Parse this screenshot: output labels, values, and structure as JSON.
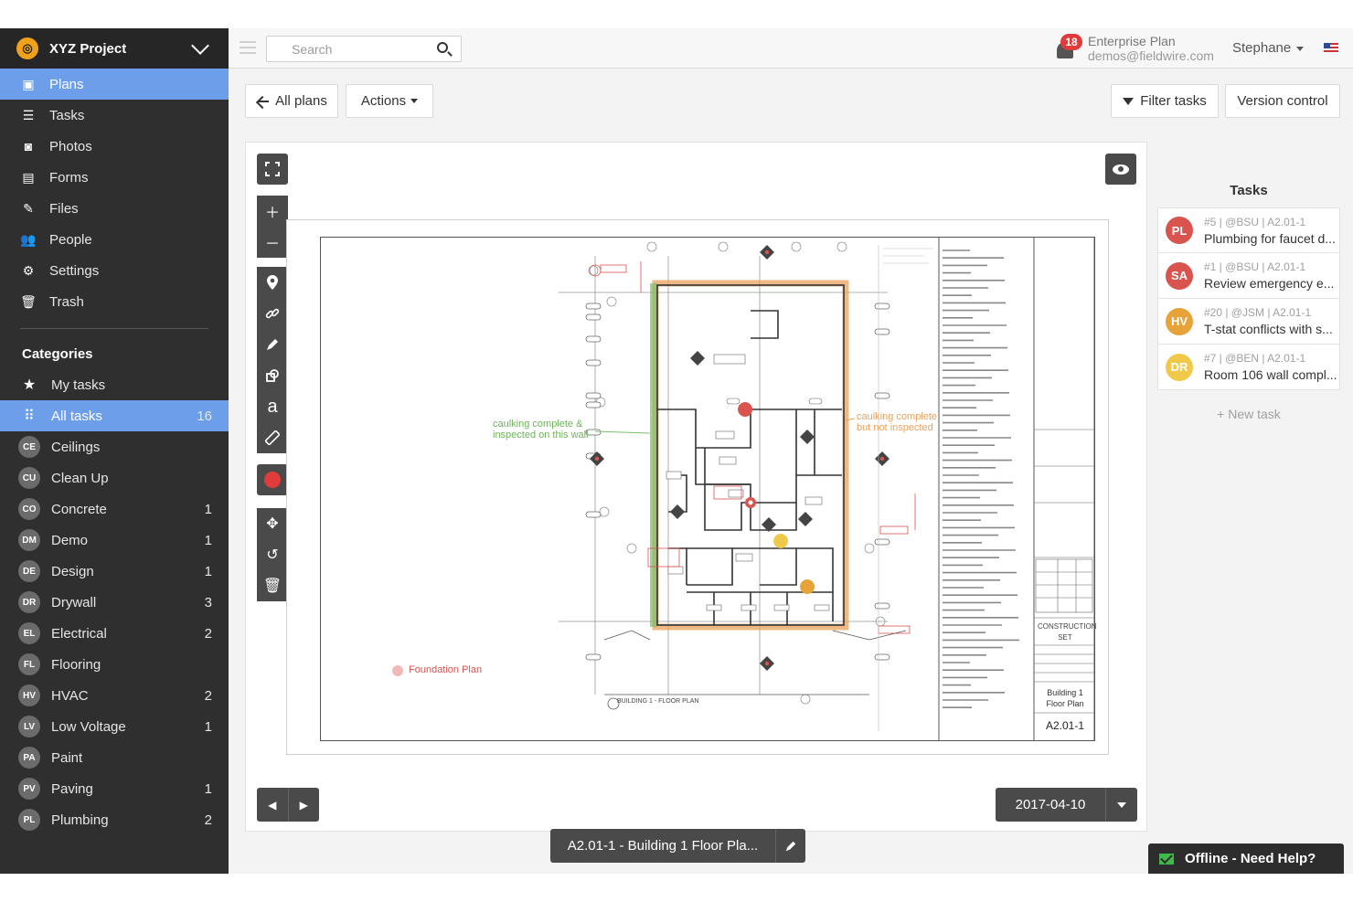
{
  "colors": {
    "sidebar_bg": "#2f2f2f",
    "accent": "#6d9ee9",
    "pin_red": "#d9534f",
    "pin_orange": "#e8a23a",
    "pin_yellow": "#f0c94a",
    "markup_orange": "#e8a25c",
    "markup_green": "#7cbf6b"
  },
  "project": {
    "name": "XYZ Project"
  },
  "nav": [
    {
      "label": "Plans",
      "icon": "plans-icon",
      "active": true
    },
    {
      "label": "Tasks",
      "icon": "list-icon"
    },
    {
      "label": "Photos",
      "icon": "camera-icon"
    },
    {
      "label": "Forms",
      "icon": "clipboard-icon"
    },
    {
      "label": "Files",
      "icon": "paperclip-icon"
    },
    {
      "label": "People",
      "icon": "people-icon"
    },
    {
      "label": "Settings",
      "icon": "gear-icon"
    },
    {
      "label": "Trash",
      "icon": "trash-icon"
    }
  ],
  "categories": {
    "title": "Categories",
    "items": [
      {
        "badge": "",
        "label": "My tasks",
        "count": ""
      },
      {
        "badge": "",
        "label": "All tasks",
        "count": "16",
        "active": true
      },
      {
        "badge": "CE",
        "label": "Ceilings",
        "count": ""
      },
      {
        "badge": "CU",
        "label": "Clean Up",
        "count": ""
      },
      {
        "badge": "CO",
        "label": "Concrete",
        "count": "1"
      },
      {
        "badge": "DM",
        "label": "Demo",
        "count": "1"
      },
      {
        "badge": "DE",
        "label": "Design",
        "count": "1"
      },
      {
        "badge": "DR",
        "label": "Drywall",
        "count": "3"
      },
      {
        "badge": "EL",
        "label": "Electrical",
        "count": "2"
      },
      {
        "badge": "FL",
        "label": "Flooring",
        "count": ""
      },
      {
        "badge": "HV",
        "label": "HVAC",
        "count": "2"
      },
      {
        "badge": "LV",
        "label": "Low Voltage",
        "count": "1"
      },
      {
        "badge": "PA",
        "label": "Paint",
        "count": ""
      },
      {
        "badge": "PV",
        "label": "Paving",
        "count": "1"
      },
      {
        "badge": "PL",
        "label": "Plumbing",
        "count": "2"
      }
    ]
  },
  "topbar": {
    "search_placeholder": "Search",
    "notifications": "18",
    "plan_name": "Enterprise Plan",
    "email": "demos@fieldwire.com",
    "user": "Stephane"
  },
  "toolbar": {
    "all_plans": "All plans",
    "actions": "Actions",
    "filter_tasks": "Filter tasks",
    "version_control": "Version control"
  },
  "viewer": {
    "version_date": "2017-04-10",
    "sheet_name": "A2.01-1 - Building 1 Floor Pla...",
    "annotations": {
      "green_note_1": "caulking complete &",
      "green_note_2": "inspected on this wall",
      "orange_note_1": "caulking complete",
      "orange_note_2": "but not inspected",
      "foundation": "Foundation Plan",
      "floor_plan_title": "BUILDING 1 - FLOOR PLAN",
      "title_block_1": "Building 1",
      "title_block_2": "Floor Plan",
      "sheet_number": "A2.01-1",
      "construction_set_1": "CONSTRUCTION",
      "construction_set_2": "SET"
    }
  },
  "tasks_panel": {
    "title": "Tasks",
    "items": [
      {
        "pin": "PL",
        "color": "#d9534f",
        "meta": "#5 | @BSU | A2.01-1",
        "title": "Plumbing for faucet d..."
      },
      {
        "pin": "SA",
        "color": "#d9534f",
        "meta": "#1 | @BSU | A2.01-1",
        "title": "Review emergency e..."
      },
      {
        "pin": "HV",
        "color": "#e8a23a",
        "meta": "#20 | @JSM | A2.01-1",
        "title": "T-stat conflicts with s..."
      },
      {
        "pin": "DR",
        "color": "#f0c94a",
        "meta": "#7 | @BEN | A2.01-1",
        "title": "Room 106 wall compl..."
      }
    ],
    "new_task": "+ New task"
  },
  "help": {
    "label": "Offline - Need Help?"
  }
}
